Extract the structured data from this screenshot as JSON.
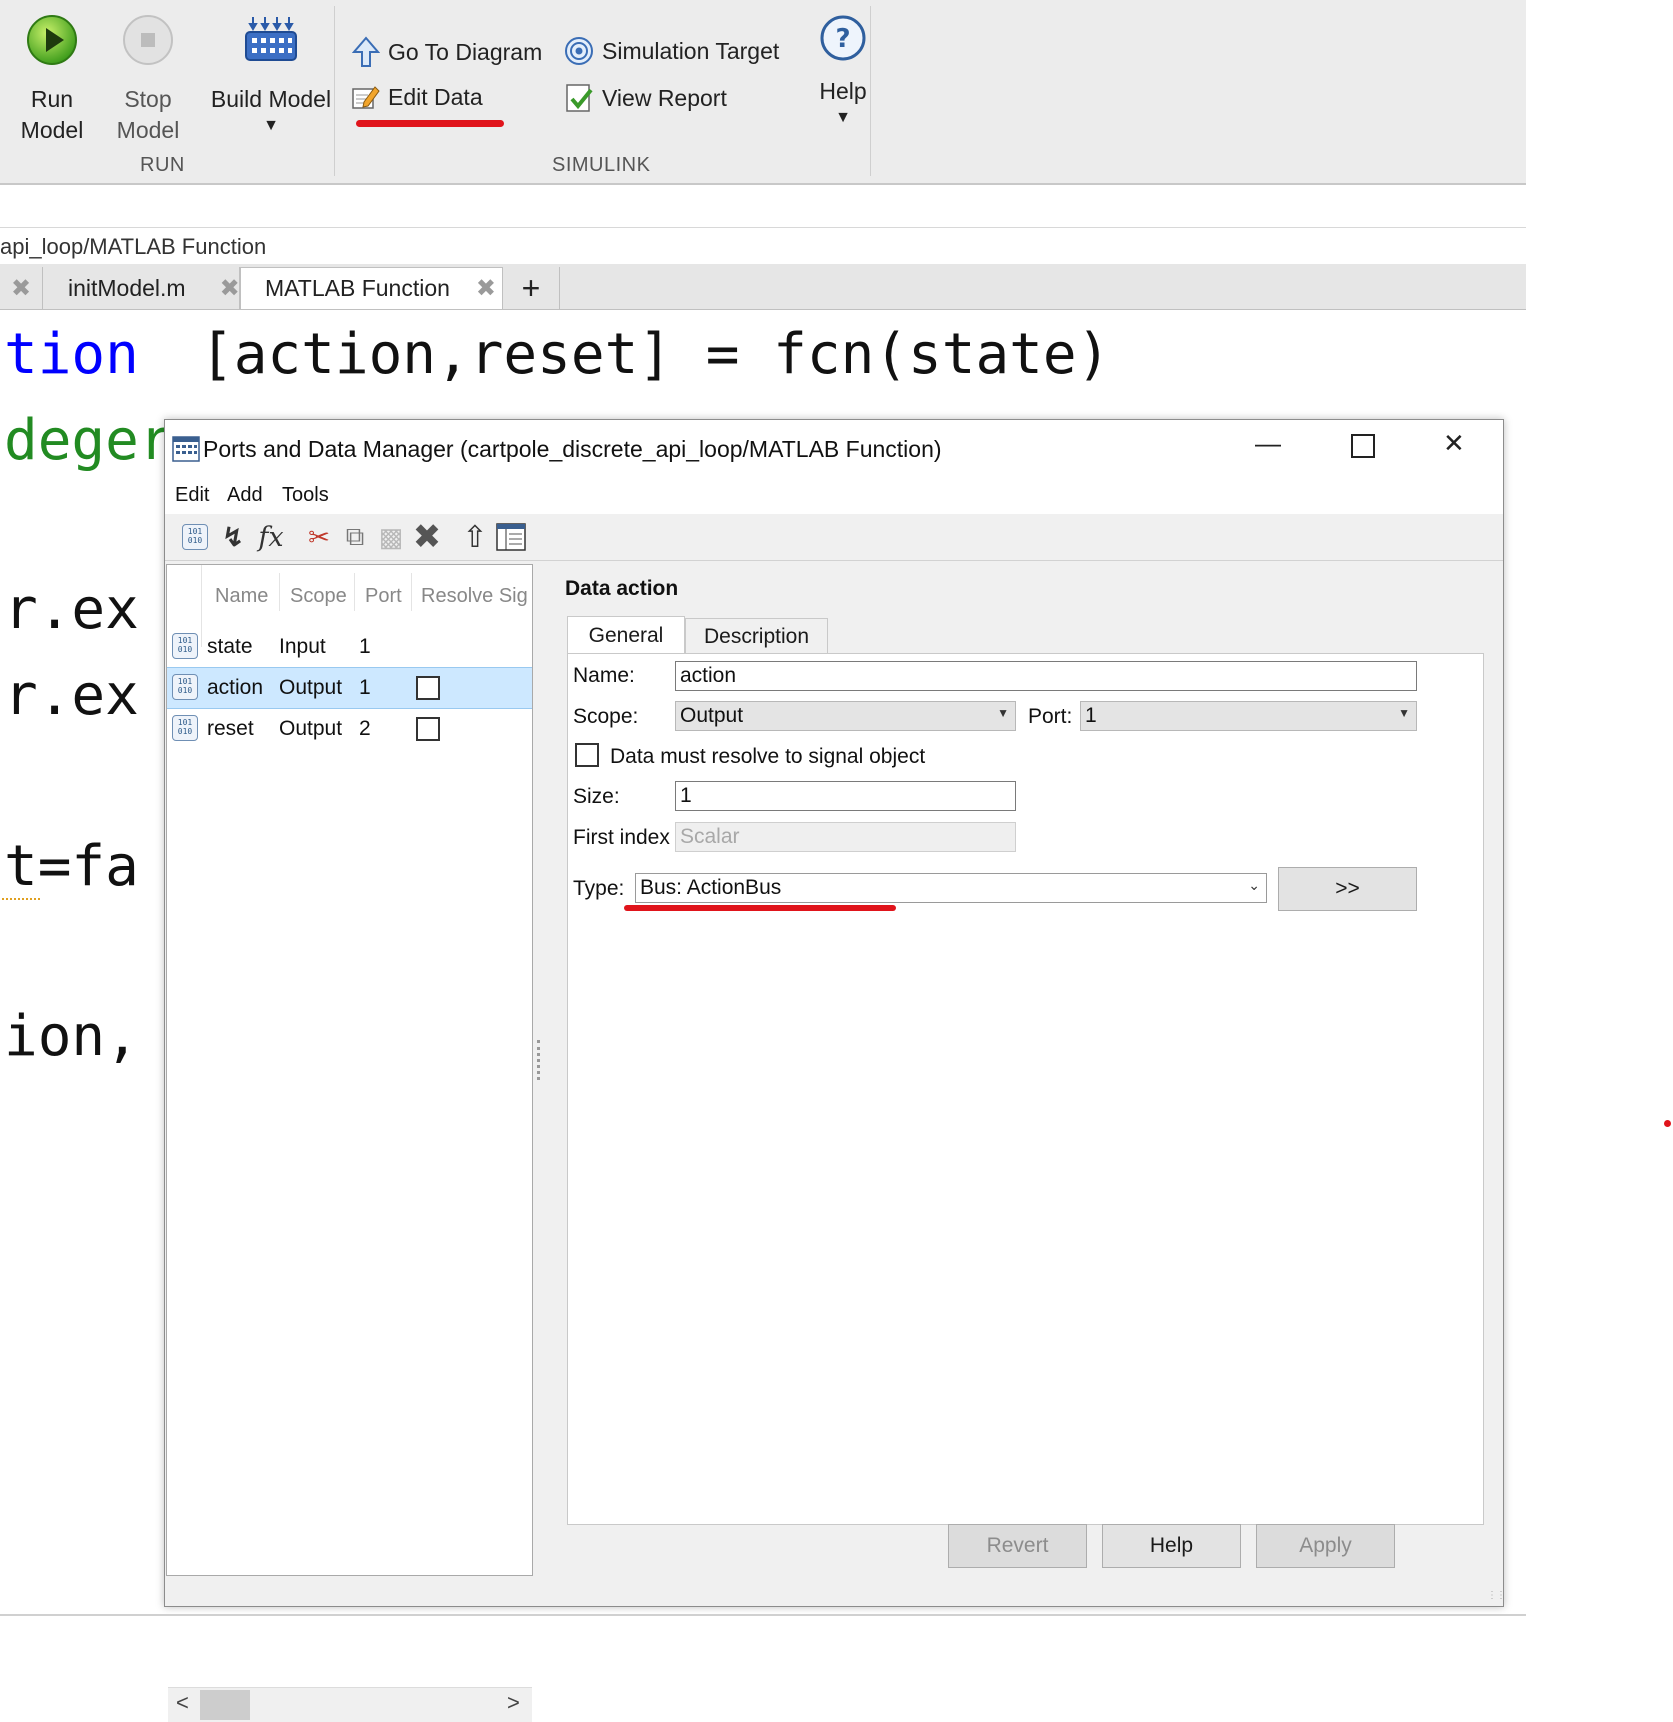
{
  "toolstrip": {
    "run": {
      "line1": "Run",
      "line2": "Model"
    },
    "stop": {
      "line1": "Stop",
      "line2": "Model"
    },
    "build": {
      "label": "Build Model"
    },
    "groups": {
      "run": "RUN",
      "simulink": "SIMULINK"
    },
    "go_to_diagram": "Go To Diagram",
    "edit_data": "Edit Data",
    "simulation_target": "Simulation Target",
    "view_report": "View Report",
    "help": "Help"
  },
  "editor": {
    "breadcrumb": "api_loop/MATLAB Function",
    "tabs": [
      {
        "label": "initModel.m"
      },
      {
        "label": "MATLAB Function"
      }
    ],
    "new_tab": "+",
    "code_lines": [
      {
        "text": "tion",
        "color": "#0000ff"
      },
      {
        "text": "[action,reset] = fcn(state)",
        "color": "#111111"
      },
      {
        "text": "deger",
        "color": "#228b22"
      },
      {
        "text": "r.ex",
        "color": "#111111"
      },
      {
        "text": "r.ex",
        "color": "#111111"
      },
      {
        "text": "t=fa",
        "color": "#111111"
      },
      {
        "text": "ion,",
        "color": "#111111"
      }
    ]
  },
  "dialog": {
    "title": "Ports and Data Manager (cartpole_discrete_api_loop/MATLAB Function)",
    "menu": [
      "Edit",
      "Add",
      "Tools"
    ],
    "list": {
      "headers": [
        "Name",
        "Scope",
        "Port",
        "Resolve Sig"
      ],
      "rows": [
        {
          "name": "state",
          "scope": "Input",
          "port": "1",
          "has_checkbox": false
        },
        {
          "name": "action",
          "scope": "Output",
          "port": "1",
          "has_checkbox": true,
          "selected": true
        },
        {
          "name": "reset",
          "scope": "Output",
          "port": "2",
          "has_checkbox": true
        }
      ],
      "scroll_left": "<",
      "scroll_right": ">"
    },
    "panel": {
      "heading": "Data action",
      "tabs": [
        "General",
        "Description"
      ],
      "name_label": "Name:",
      "name_value": "action",
      "scope_label": "Scope:",
      "scope_value": "Output",
      "port_label": "Port:",
      "port_value": "1",
      "resolve_label": "Data must resolve to signal object",
      "size_label": "Size:",
      "size_value": "1",
      "first_index_label": "First index",
      "first_index_value": "Scalar",
      "type_label": "Type:",
      "type_value": "Bus: ActionBus",
      "type_button": ">>"
    },
    "buttons": {
      "revert": "Revert",
      "help": "Help",
      "apply": "Apply"
    }
  },
  "colors": {
    "accent_red": "#e0141b",
    "selection": "#cde8ff",
    "toolstrip_bg": "#ececec"
  }
}
